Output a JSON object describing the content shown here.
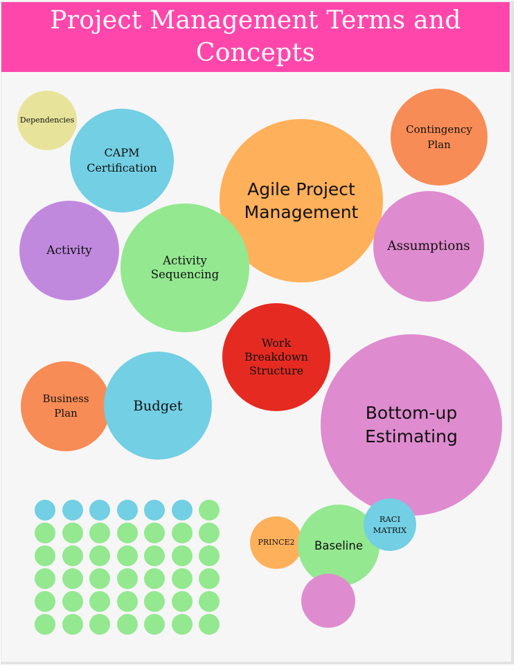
{
  "header": {
    "title": "Project Management Terms and Concepts",
    "background_color": "#ff47ab",
    "text_color": "#ffffff"
  },
  "palette": {
    "yellow": "#e8e39a",
    "blue": "#72cfe4",
    "purple": "#c089de",
    "green": "#93e890",
    "light_orange": "#ffb05a",
    "orange": "#f78c56",
    "pink": "#df8bcf",
    "red": "#e52a21"
  },
  "bubbles": [
    {
      "id": "dependencies",
      "label": "Dependencies",
      "color": "yellow"
    },
    {
      "id": "capm-certification",
      "label": "CAPM Certification",
      "color": "blue"
    },
    {
      "id": "agile-project-management",
      "label": "Agile Project Management",
      "color": "light_orange"
    },
    {
      "id": "contingency-plan",
      "label": "Contingency Plan",
      "color": "orange"
    },
    {
      "id": "activity",
      "label": "Activity",
      "color": "purple"
    },
    {
      "id": "activity-sequencing",
      "label": "Activity Sequencing",
      "color": "green"
    },
    {
      "id": "assumptions",
      "label": "Assumptions",
      "color": "pink"
    },
    {
      "id": "work-breakdown-structure",
      "label": "Work Breakdown Structure",
      "color": "red"
    },
    {
      "id": "business-plan",
      "label": "Business Plan",
      "color": "orange"
    },
    {
      "id": "budget",
      "label": "Budget",
      "color": "blue"
    },
    {
      "id": "bottom-up-estimating",
      "label": "Bottom-up Estimating",
      "color": "pink"
    },
    {
      "id": "prince2",
      "label": "PRINCE2",
      "color": "light_orange"
    },
    {
      "id": "baseline",
      "label": "Baseline",
      "color": "green"
    },
    {
      "id": "raci-matrix",
      "label": "RACI MATRIX",
      "color": "blue"
    },
    {
      "id": "unlabeled-pink",
      "label": "",
      "color": "pink"
    }
  ],
  "dot_grid": {
    "rows": 6,
    "columns": 7,
    "highlighted_count": 6,
    "highlight_color": "blue",
    "base_color": "green"
  }
}
